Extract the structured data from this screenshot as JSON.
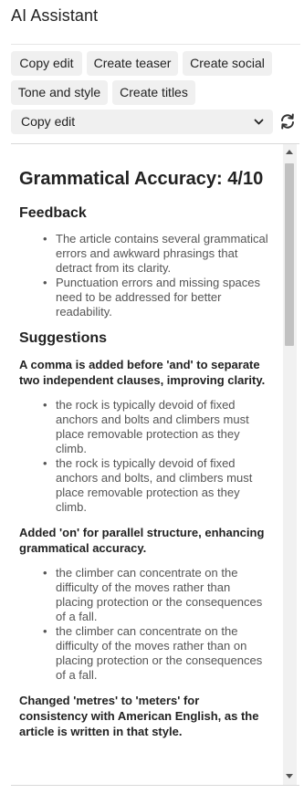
{
  "app": {
    "title": "AI Assistant"
  },
  "actions": {
    "copy_edit": "Copy edit",
    "create_teaser": "Create teaser",
    "create_social": "Create social",
    "tone_and_style": "Tone and style",
    "create_titles": "Create titles"
  },
  "mode_select": {
    "selected": "Copy edit"
  },
  "icons": {
    "dropdown": "chevron-down-icon",
    "refresh": "refresh-icon"
  },
  "result": {
    "heading": "Grammatical Accuracy: 4/10",
    "feedback_title": "Feedback",
    "feedback": [
      "The article contains several grammatical errors and awkward phrasings that detract from its clarity.",
      "Punctuation errors and missing spaces need to be addressed for better readability."
    ],
    "suggestions_title": "Suggestions",
    "suggestions": [
      {
        "title": "A comma is added before 'and' to separate two independent clauses, improving clarity.",
        "items": [
          "the rock is typically devoid of fixed anchors and bolts and climbers must place removable protection as they climb.",
          "the rock is typically devoid of fixed anchors and bolts, and climbers must place removable protection as they climb."
        ]
      },
      {
        "title": "Added 'on' for parallel structure, enhancing grammatical accuracy.",
        "items": [
          "the climber can concentrate on the difficulty of the moves rather than placing protection or the consequences of a fall.",
          "the climber can concentrate on the difficulty of the moves rather than on placing protection or the consequences of a fall."
        ]
      },
      {
        "title": "Changed 'metres' to 'meters' for consistency with American English, as the article is written in that style.",
        "items": []
      }
    ]
  }
}
